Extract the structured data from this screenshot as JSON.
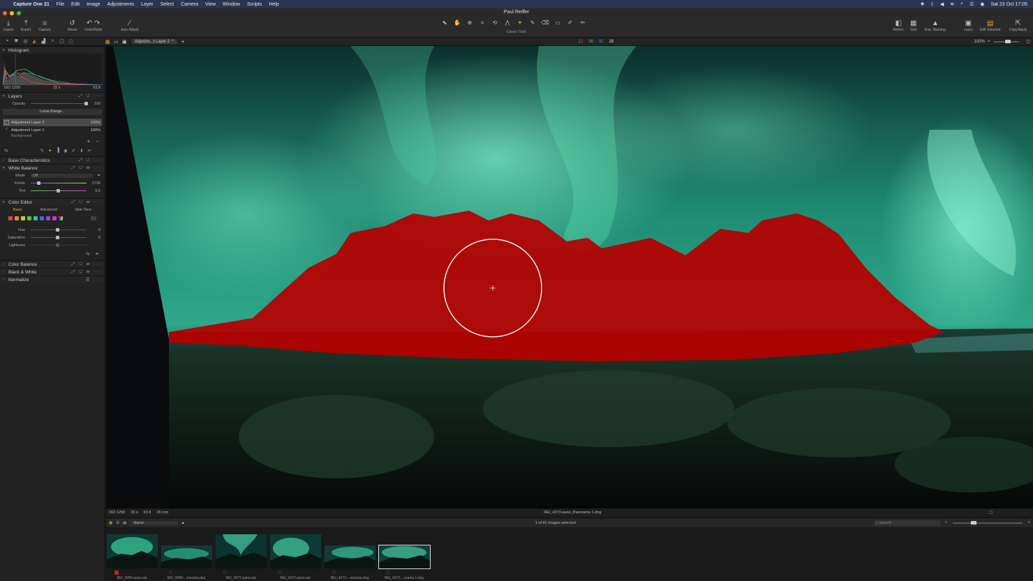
{
  "menubar": {
    "app": "Capture One 21",
    "items": [
      "File",
      "Edit",
      "Image",
      "Adjustments",
      "Layer",
      "Select",
      "Camera",
      "View",
      "Window",
      "Scripts",
      "Help"
    ],
    "clock": "Sat 23 Oct  17:05"
  },
  "window": {
    "title": "Paul Reiffer"
  },
  "toolbar": {
    "import": "Import",
    "export": "Export",
    "capture": "Capture",
    "reset": "Reset",
    "undo_redo": "Undo/Redo",
    "auto_adjust": "Auto Adjust",
    "cursor_tools": "Cursor Tools",
    "before": "Before",
    "grid": "Grid",
    "exp_warning": "Exp. Warning",
    "learn": "Learn",
    "edit_selected": "Edit Selected",
    "copy_apply": "Copy/Apply"
  },
  "subbar": {
    "layer_select": "Adjustm...t Layer 2 ⌃",
    "count_red": "12",
    "count_green": "36",
    "count_blue": "32",
    "count_white": "28",
    "zoom": "100%"
  },
  "histogram": {
    "title": "Histogram",
    "iso": "ISO 1250",
    "shutter": "15 s",
    "aperture": "f/2.8"
  },
  "layers": {
    "title": "Layers",
    "opacity_label": "Opacity",
    "opacity_value": "100",
    "opacity_level": 1.0,
    "luma_range": "Luma Range...",
    "items": [
      {
        "name": "Adjustment Layer 2",
        "pct": "100%"
      },
      {
        "name": "Adjustment Layer 1",
        "pct": "100%"
      },
      {
        "name": "Background",
        "pct": ""
      }
    ]
  },
  "base_characteristics": {
    "title": "Base Characteristics"
  },
  "white_balance": {
    "title": "White Balance",
    "mode_label": "Mode",
    "mode_value": "Off",
    "kelvin_label": "Kelvin",
    "kelvin_value": "2736",
    "kelvin_level": 0.15,
    "tint_label": "Tint",
    "tint_value": "0.5",
    "tint_level": 0.5
  },
  "color_editor": {
    "title": "Color Editor",
    "tabs": [
      "Basic",
      "Advanced",
      "Skin Tone"
    ],
    "swatches": [
      "#d44a3a",
      "#d98a3a",
      "#cfc23a",
      "#5fb84a",
      "#3ab8a8",
      "#3a6ad4",
      "#8a4ad4",
      "#d43aa8"
    ],
    "hue_label": "Hue",
    "hue_value": "0",
    "saturation_label": "Saturation",
    "saturation_value": "0",
    "lightness_label": "Lightness"
  },
  "color_balance": {
    "title": "Color Balance"
  },
  "black_white": {
    "title": "Black & White"
  },
  "normalize": {
    "title": "Normalize"
  },
  "imagebar": {
    "iso": "ISO 1250",
    "shutter": "15 s",
    "aperture": "f/2.8",
    "focal": "15 mm",
    "filename": "REI_4373-pano_Panorama 1.dng"
  },
  "browserbar": {
    "sort": "Name",
    "selection": "1 of 91 images selected",
    "search_placeholder": "Search"
  },
  "thumbnails": [
    {
      "name": "REI_4356-pano.eip"
    },
    {
      "name": "REI_4356-...norama.dng"
    },
    {
      "name": "REI_4372-pano.eip"
    },
    {
      "name": "REI_4373-pano.eip"
    },
    {
      "name": "REI_4373-...norama.dng"
    },
    {
      "name": "REI_4373-...orama 1.dng"
    }
  ],
  "colors": {
    "accent": "#e3a13a",
    "mask": "#b80000",
    "aurora": "#2fc79a",
    "menubar": "#2b3450"
  }
}
